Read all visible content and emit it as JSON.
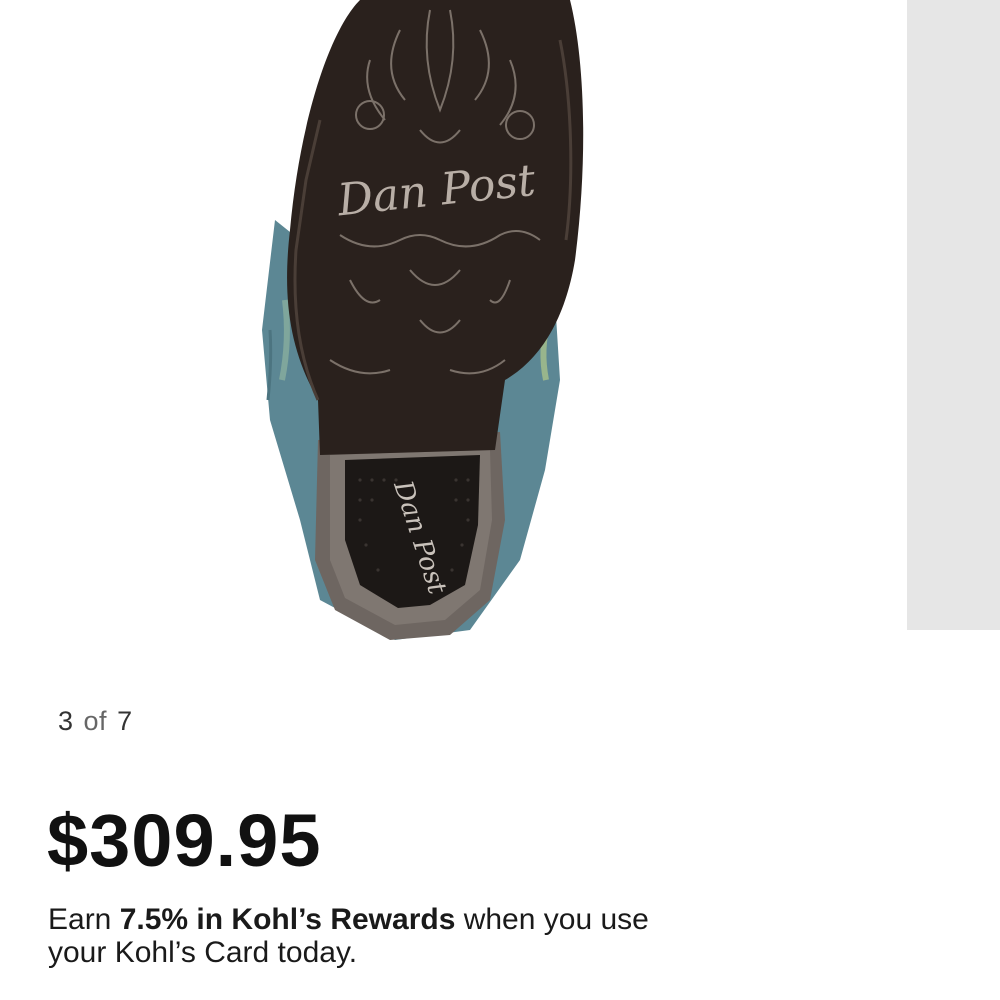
{
  "product_image": {
    "brand_mark": "Dan Post",
    "alt": "boot sole",
    "colors": {
      "sole": "#2a211d",
      "leather": "#5c8794",
      "heel_wood": "#6e6661",
      "peek_panel": "#e6e6e6"
    }
  },
  "carousel": {
    "current": "3",
    "of_label": "of",
    "total": "7"
  },
  "price": "$309.95",
  "rewards": {
    "prefix": "Earn ",
    "highlight": "7.5% in Kohl’s Rewards",
    "suffix": " when you use your Kohl’s Card today."
  }
}
